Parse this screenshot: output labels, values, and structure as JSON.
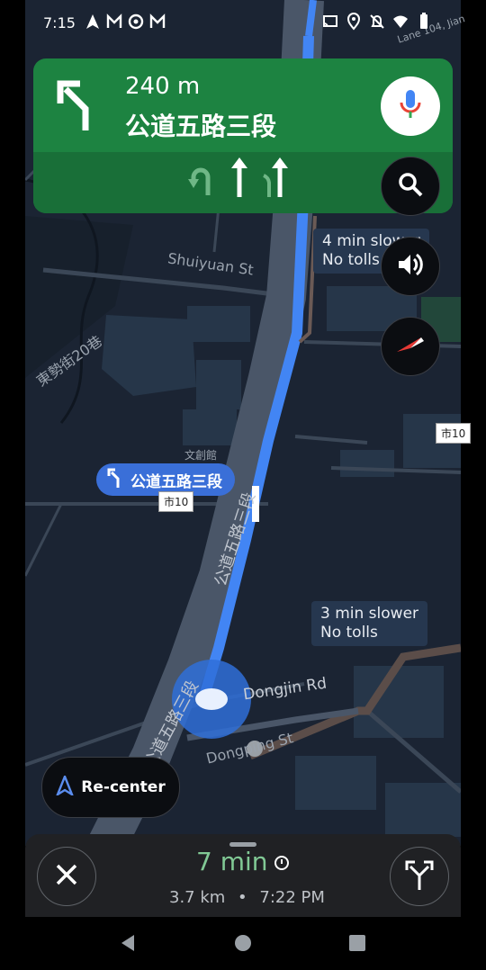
{
  "status_bar": {
    "time": "7:15",
    "left_icons": [
      "navigation-arrow-icon",
      "gmail-icon",
      "chrome-icon",
      "gmail-icon"
    ],
    "right_icons": [
      "cast-icon",
      "location-pin-icon",
      "notifications-off-icon",
      "wifi-icon",
      "battery-icon"
    ]
  },
  "banner": {
    "distance": "240 m",
    "street": "公道五路三段",
    "turn_icon": "slight-left-turn-icon",
    "lanes": [
      "u-turn-left-lane-icon",
      "straight-lane-icon",
      "straight-lane-icon"
    ],
    "color": "#1d8341"
  },
  "map": {
    "callout_top": {
      "line1": "4 min slower",
      "line2": "No tolls"
    },
    "callout_bottom": {
      "line1": "3 min slower",
      "line2": "No tolls"
    },
    "road_chip": "公道五路三段",
    "shield_left": "市10",
    "shield_right": "市10",
    "labels": {
      "shuiyuan": "Shuiyuan St",
      "dongshi": "東勢街20巷",
      "gongdao_vertical": "公道五路三段",
      "gongdao_lower": "公道五路三段",
      "dongjin": "Dongjin Rd",
      "dongping": "Dongping St",
      "wenhua": "文創館",
      "lane_top": "Lane 104, Jian"
    },
    "route_color": "#4285f4"
  },
  "recenter": {
    "label": "Re-center"
  },
  "bottom_sheet": {
    "eta_time": "7 min",
    "distance": "3.7 km",
    "separator": "•",
    "arrival": "7:22 PM"
  }
}
